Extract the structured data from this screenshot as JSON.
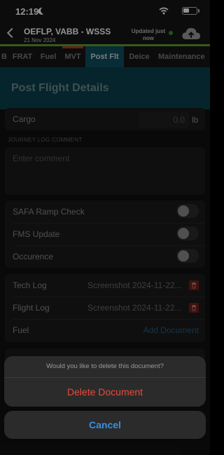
{
  "status_bar": {
    "time": "12:19"
  },
  "header": {
    "route": "OEFLP, VABB - WSSS",
    "date": "21 Nov 2024",
    "sync_status": "Updated just now"
  },
  "tabs": [
    {
      "label": "B",
      "active": false
    },
    {
      "label": "FRAT",
      "active": false
    },
    {
      "label": "Fuel",
      "active": false
    },
    {
      "label": "MVT",
      "active": false
    },
    {
      "label": "Post Flt",
      "active": true
    },
    {
      "label": "Deice",
      "active": false
    },
    {
      "label": "Maintenance",
      "active": false
    }
  ],
  "section": {
    "title": "Post Flight Details"
  },
  "cargo": {
    "label": "Cargo",
    "placeholder": "0.0",
    "unit": "lb"
  },
  "journey_log": {
    "label": "JOURNEY LOG COMMENT",
    "placeholder": "Enter comment"
  },
  "toggles": [
    {
      "label": "SAFA Ramp Check",
      "on": false
    },
    {
      "label": "FMS Update",
      "on": false
    },
    {
      "label": "Occurence",
      "on": false
    }
  ],
  "documents": [
    {
      "label": "Tech Log",
      "value": "Screenshot 2024-11-22..."
    },
    {
      "label": "Flight Log",
      "value": "Screenshot 2024-11-22..."
    },
    {
      "label": "Fuel",
      "action": "Add Document"
    }
  ],
  "action_sheet": {
    "message": "Would you like to delete this document?",
    "destructive_label": "Delete Document",
    "cancel_label": "Cancel"
  },
  "colors": {
    "accent_green": "#5a9e33",
    "active_tab_bg": "#0e4e5f",
    "destructive": "#e64b3c",
    "cancel_blue": "#3a8fe0"
  }
}
